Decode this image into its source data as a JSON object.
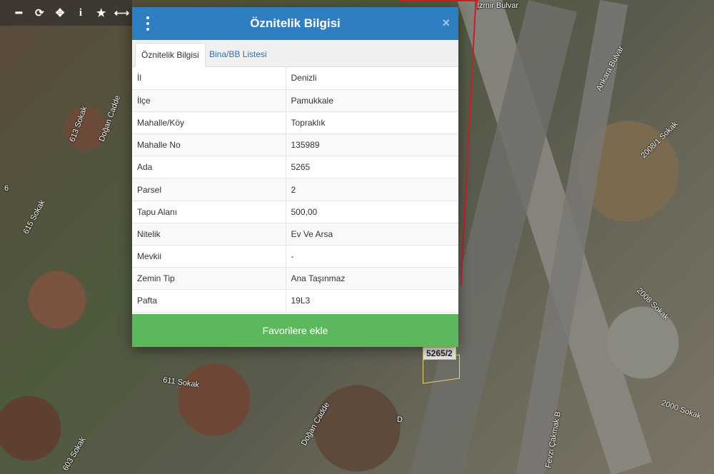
{
  "toolbar": {
    "buttons": [
      {
        "name": "zoom-out",
        "glyph": "━"
      },
      {
        "name": "refresh",
        "glyph": "⟳"
      },
      {
        "name": "locate",
        "glyph": "✥"
      },
      {
        "name": "info",
        "glyph": "i"
      },
      {
        "name": "favorite",
        "glyph": "★"
      },
      {
        "name": "measure",
        "glyph": "⟷"
      }
    ]
  },
  "map": {
    "labels": {
      "izmir_bulvar": "İzmir Bulvar",
      "ankara_bulvar": "Ankara Bulvar",
      "sokak_2008_1": "2008/1 Sokak",
      "sokak_2008": "2008 Sokak",
      "sokak_2000": "2000 Sokak",
      "sokak_613": "613 Sokak",
      "sokak_615": "615 Sokak",
      "sokak_611": "611 Sokak",
      "dogan_cadde_top": "Doğan Cadde",
      "dogan_cadde_bottom": "Doğan Cadde",
      "sokak_603": "603 Sokak",
      "sokak_6": "6",
      "fevzi_cakmak": "Fevzi Çakmak B",
      "letter_d": "D"
    },
    "parcel_tag": "5265/2"
  },
  "modal": {
    "title": "Öznitelik Bilgisi",
    "close": "×",
    "tabs": [
      {
        "label": "Öznitelik Bilgisi",
        "active": true
      },
      {
        "label": "Bina/BB Listesi",
        "active": false
      }
    ],
    "rows": [
      {
        "key": "İl",
        "value": "Denizli"
      },
      {
        "key": "İlçe",
        "value": "Pamukkale"
      },
      {
        "key": "Mahalle/Köy",
        "value": "Topraklık"
      },
      {
        "key": "Mahalle No",
        "value": "135989"
      },
      {
        "key": "Ada",
        "value": "5265"
      },
      {
        "key": "Parsel",
        "value": "2"
      },
      {
        "key": "Tapu Alanı",
        "value": "500,00"
      },
      {
        "key": "Nitelik",
        "value": "Ev Ve Arsa"
      },
      {
        "key": "Mevkii",
        "value": "-"
      },
      {
        "key": "Zemin Tip",
        "value": "Ana Taşınmaz"
      },
      {
        "key": "Pafta",
        "value": "19L3"
      }
    ],
    "favorite_button": "Favorilere ekle"
  },
  "colors": {
    "header": "#2f7ec1",
    "favorite": "#5cb85c",
    "tab_link": "#2a6fb3",
    "parcel_line": "#c8202a"
  }
}
